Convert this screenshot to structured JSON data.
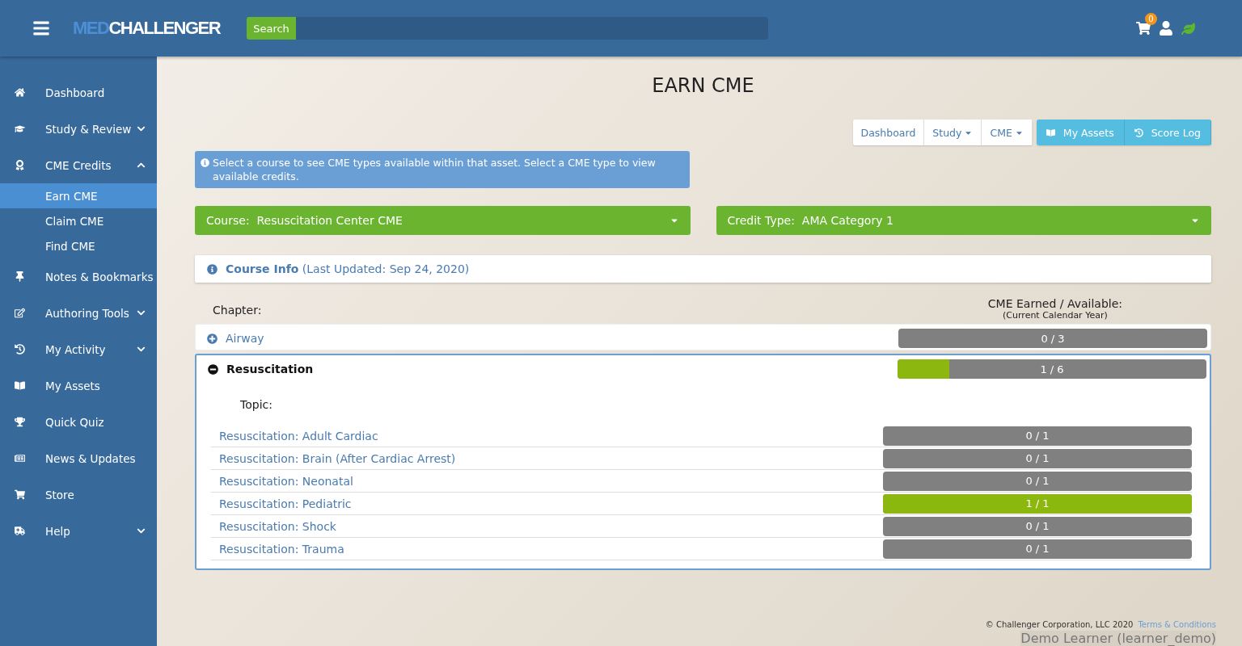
{
  "header": {
    "logo": {
      "part1": "MED",
      "part2": "CHALLENGER"
    },
    "search_button": "Search",
    "cart_count": "0"
  },
  "sidebar": {
    "items": [
      {
        "label": "Dashboard"
      },
      {
        "label": "Study & Review",
        "expanded": false
      },
      {
        "label": "CME Credits",
        "expanded": true,
        "children": [
          {
            "label": "Earn CME",
            "selected": true
          },
          {
            "label": "Claim CME",
            "selected": false
          },
          {
            "label": "Find CME",
            "selected": false
          }
        ]
      },
      {
        "label": "Notes & Bookmarks"
      },
      {
        "label": "Authoring Tools",
        "expanded": false
      },
      {
        "label": "My Activity",
        "expanded": false
      },
      {
        "label": "My Assets"
      },
      {
        "label": "Quick Quiz"
      },
      {
        "label": "News & Updates"
      },
      {
        "label": "Store"
      },
      {
        "label": "Help",
        "expanded": false
      }
    ]
  },
  "page_title": "EARN CME",
  "toolbar": {
    "nav": [
      {
        "label": "Dashboard",
        "dropdown": false
      },
      {
        "label": "Study",
        "dropdown": true
      },
      {
        "label": "CME",
        "dropdown": true
      }
    ],
    "actions": [
      {
        "label": "My Assets"
      },
      {
        "label": "Score Log"
      }
    ]
  },
  "notice": "Select a course to see CME types available within that asset. Select a CME type to view available credits.",
  "course_select": {
    "label": "Course:",
    "value": "Resuscitation Center CME"
  },
  "credit_select": {
    "label": "Credit Type:",
    "value": "AMA Category 1"
  },
  "course_info": {
    "title": "Course Info",
    "updated": "(Last Updated: Sep 24, 2020)"
  },
  "chapter_header": "Chapter:",
  "earned_header": "CME Earned / Available:",
  "earned_subheader": "(Current Calendar Year)",
  "topic_header": "Topic:",
  "chapters": [
    {
      "name": "Airway",
      "expanded": false,
      "reading": "0 / 3",
      "level": 0
    },
    {
      "name": "Resuscitation",
      "expanded": true,
      "reading": "1 / 6",
      "level": 0.1667,
      "topics": [
        {
          "name": "Resuscitation: Adult Cardiac",
          "reading": "0 / 1",
          "level": 0
        },
        {
          "name": "Resuscitation: Brain (After Cardiac Arrest)",
          "reading": "0 / 1",
          "level": 0
        },
        {
          "name": "Resuscitation: Neonatal",
          "reading": "0 / 1",
          "level": 0
        },
        {
          "name": "Resuscitation: Pediatric",
          "reading": "1 / 1",
          "level": 1
        },
        {
          "name": "Resuscitation: Shock",
          "reading": "0 / 1",
          "level": 0
        },
        {
          "name": "Resuscitation: Trauma",
          "reading": "0 / 1",
          "level": 0
        }
      ]
    }
  ],
  "footer": {
    "copyright": "© Challenger Corporation, LLC 2020",
    "link": "Terms & Conditions",
    "user": "Demo Learner (learner_demo)"
  }
}
